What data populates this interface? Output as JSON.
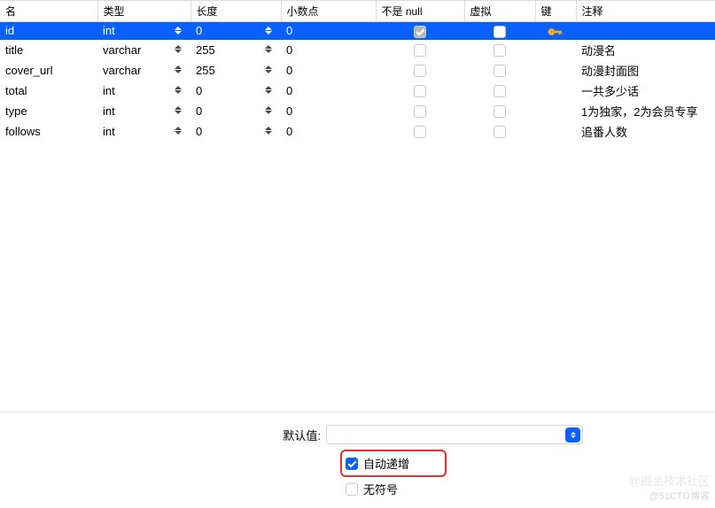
{
  "headers": {
    "name": "名",
    "type": "类型",
    "length": "长度",
    "decimal": "小数点",
    "notnull": "不是 null",
    "virtual": "虚拟",
    "key": "键",
    "comment": "注释"
  },
  "rows": [
    {
      "name": "id",
      "type": "int",
      "length": "0",
      "decimal": "0",
      "notnull": true,
      "virtual": false,
      "key": true,
      "comment": "",
      "selected": true
    },
    {
      "name": "title",
      "type": "varchar",
      "length": "255",
      "decimal": "0",
      "notnull": false,
      "virtual": false,
      "key": false,
      "comment": "动漫名",
      "selected": false
    },
    {
      "name": "cover_url",
      "type": "varchar",
      "length": "255",
      "decimal": "0",
      "notnull": false,
      "virtual": false,
      "key": false,
      "comment": "动漫封面图",
      "selected": false
    },
    {
      "name": "total",
      "type": "int",
      "length": "0",
      "decimal": "0",
      "notnull": false,
      "virtual": false,
      "key": false,
      "comment": "一共多少话",
      "selected": false
    },
    {
      "name": "type",
      "type": "int",
      "length": "0",
      "decimal": "0",
      "notnull": false,
      "virtual": false,
      "key": false,
      "comment": "1为独家，2为会员专享",
      "selected": false
    },
    {
      "name": "follows",
      "type": "int",
      "length": "0",
      "decimal": "0",
      "notnull": false,
      "virtual": false,
      "key": false,
      "comment": "追番人数",
      "selected": false
    }
  ],
  "bottom": {
    "default_label": "默认值:",
    "default_value": "",
    "auto_increment_label": "自动递增",
    "auto_increment": true,
    "unsigned_label": "无符号",
    "unsigned": false
  },
  "watermark": "@51CTO博客",
  "watermark2": "@掘金技术社区"
}
